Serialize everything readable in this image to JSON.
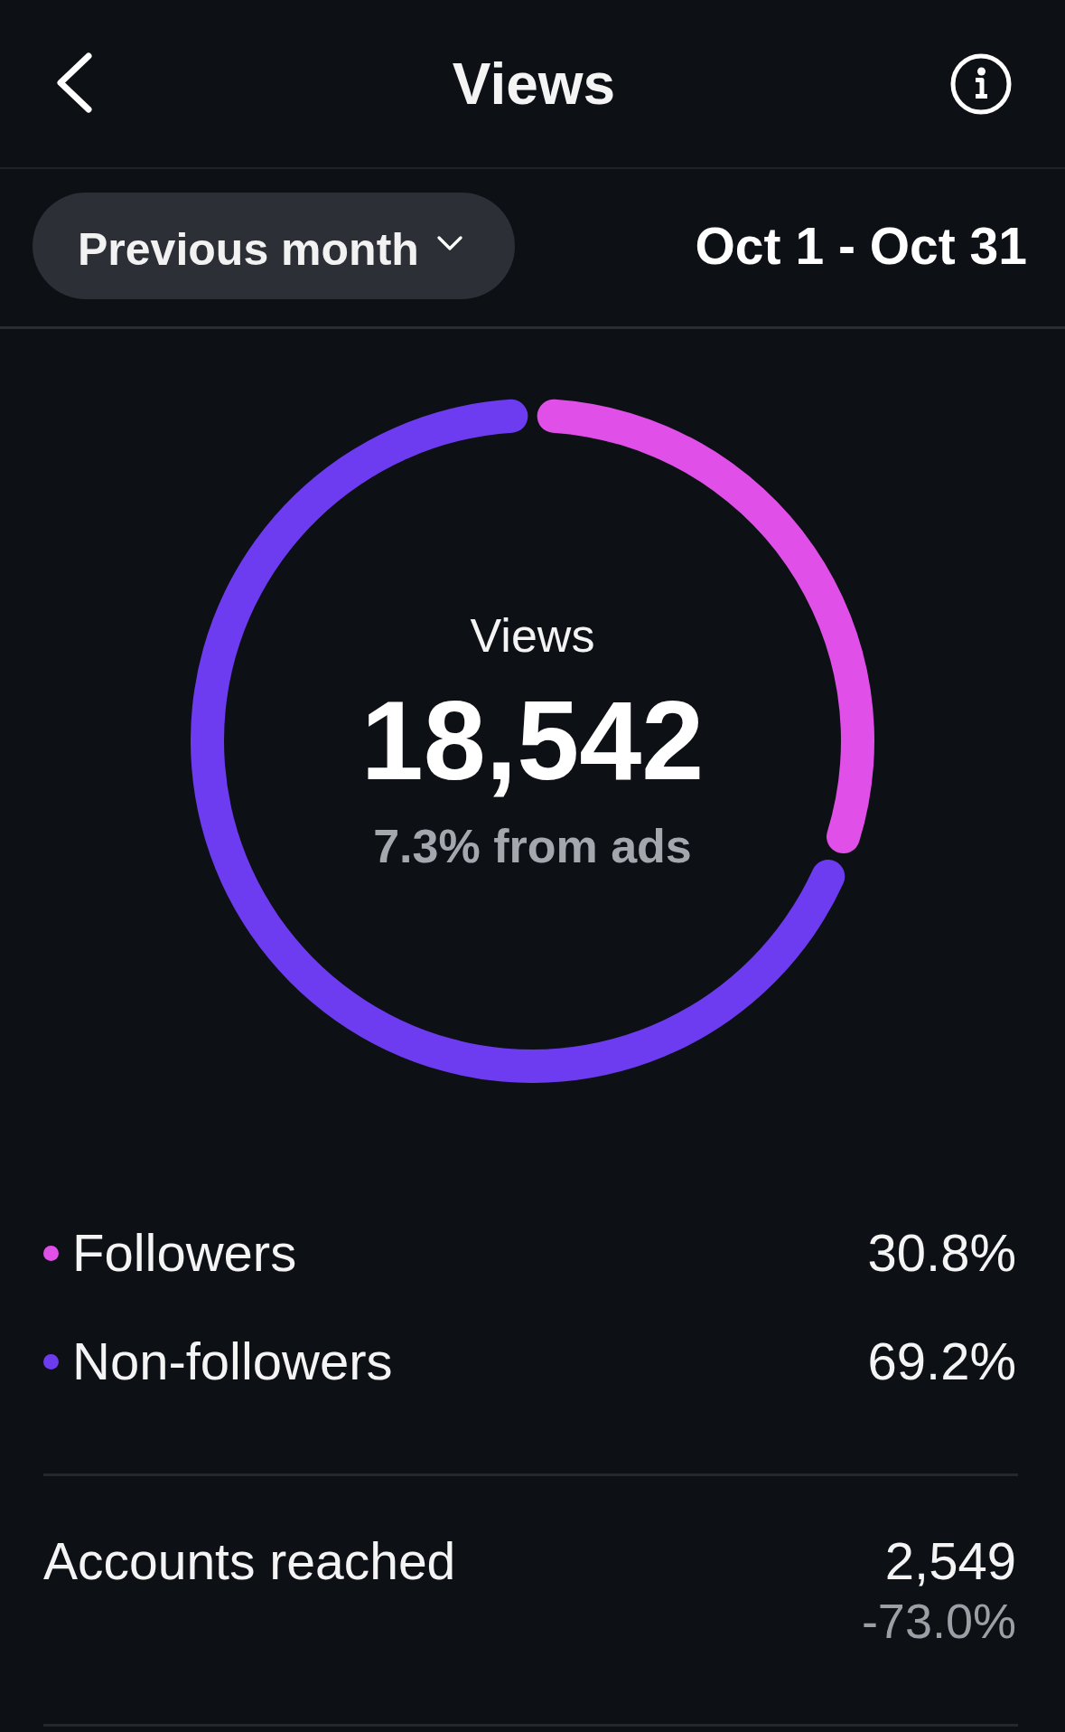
{
  "header": {
    "title": "Views"
  },
  "filter": {
    "period": "Previous month",
    "date_range": "Oct 1 - Oct 31"
  },
  "summary": {
    "label": "Views",
    "total": "18,542",
    "note": "7.3% from ads"
  },
  "audience": {
    "chart_data": {
      "type": "donut",
      "categories": [
        "Followers",
        "Non-followers"
      ],
      "values": [
        30.8,
        69.2
      ],
      "legend": "bottom"
    },
    "shares": [
      {
        "value": "30.8%",
        "color": "#e04fe8"
      },
      {
        "value": "69.2%",
        "color": "#6d3cf0"
      }
    ]
  },
  "metrics": [
    {
      "label": "Accounts reached",
      "value": "2,549",
      "change": "-73.0%"
    }
  ]
}
